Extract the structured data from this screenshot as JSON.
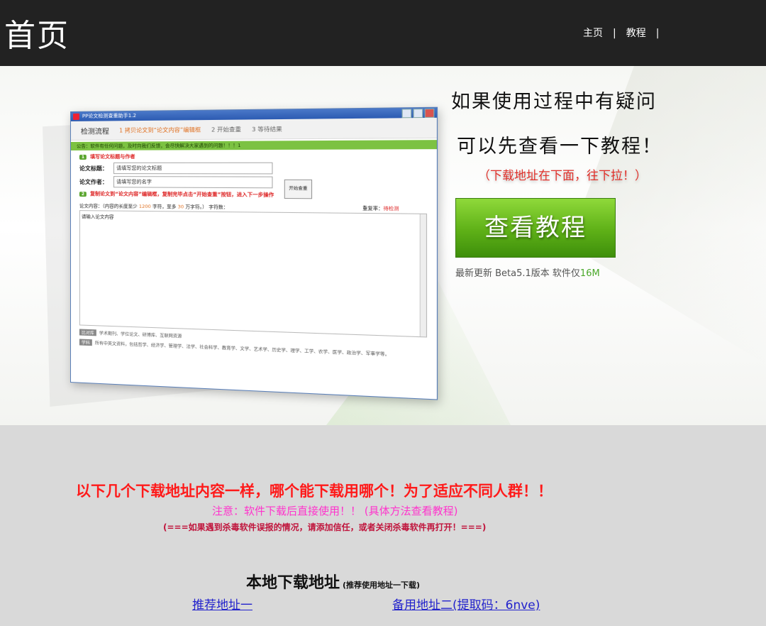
{
  "header": {
    "logo": "首页",
    "nav": [
      {
        "label": "主页"
      },
      {
        "label": "教程"
      }
    ],
    "separator": "|"
  },
  "app_screenshot": {
    "title": "PP论文检测查重助手1.2",
    "steps": [
      "检测流程",
      "1  拷贝论文到“论文内容”编辑框",
      "2  开始查重",
      "3  等待结果"
    ],
    "notice": "公告：软件有任何问题，及时向我们反馈，会尽快解决大家遇到的问题！！！1",
    "step1_badge": "1",
    "step1": "填写论文标题与作者",
    "title_label": "论文标题：",
    "title_value": "请填写您的论文标题",
    "author_label": "论文作者：",
    "author_value": "请填写您的名字",
    "check_button": "开始查重",
    "step2_badge": "2",
    "step2": "复制论文到“论文内容”编辑框，复制完毕点击“开始查重”按钮，进入下一步操作",
    "content_prefix": "论文内容：（内容的长度至少",
    "content_min": "1200",
    "content_mid": "字符，至多",
    "content_max": "30",
    "content_suffix": "万字符。）  字符数：",
    "repeat_label": "重复率：",
    "repeat_value": "待检测",
    "textarea_placeholder": "请输入论文内容",
    "footer1_tag": "比对库",
    "footer1": "学术期刊、学位论文、研博库、互联网资源",
    "footer2_tag": "学科",
    "footer2": "所有中英文资料，包括哲学、经济学、管理学、法学、社会科学、教育学、文学、艺术学、历史学、理学、工学、农学、医学、政治学、军事学等。"
  },
  "hero": {
    "line1": "如果使用过程中有疑问",
    "line2": "可以先查看一下教程！",
    "hint": "（下载地址在下面，往下拉！）",
    "button": "查看教程",
    "version_prefix": "最新更新  Beta5.1版本  软件仅",
    "version_size": "16M"
  },
  "download": {
    "headline": "以下几个下载地址内容一样，哪个能下载用哪个！为了适应不同人群！！",
    "note": "注意：软件下载后直接使用！！ (具体方法查看教程)",
    "warning": "(===如果遇到杀毒软件误报的情况，请添加信任，或者关闭杀毒软件再打开！===)",
    "local_title": "本地下载地址",
    "local_hint": "(推荐使用地址一下载)",
    "link1": "推荐地址一",
    "link2": "备用地址二(提取码：6nve)"
  },
  "colors": {
    "header_bg": "#222222",
    "button_green": "#5eb017",
    "headline_red": "#ff1a1a",
    "note_pink": "#ff33cc",
    "link_blue": "#2222cc"
  }
}
